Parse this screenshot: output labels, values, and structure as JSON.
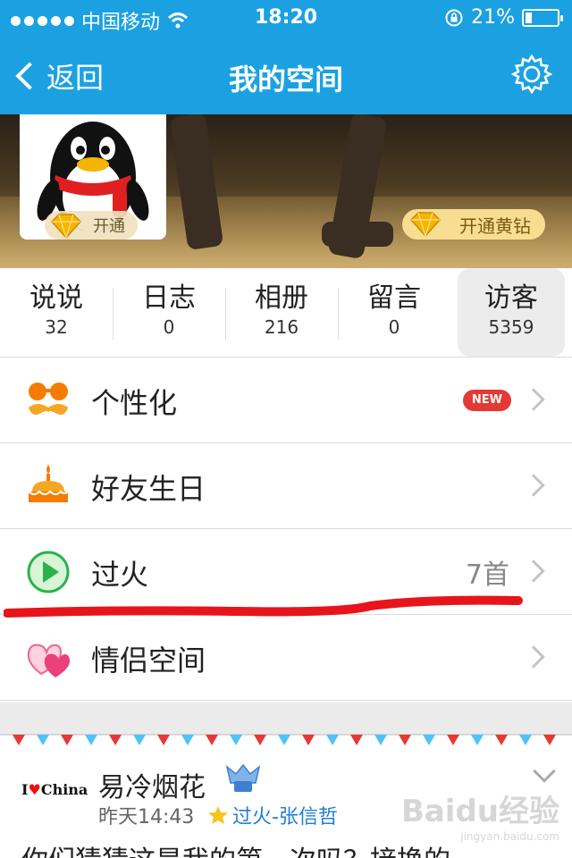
{
  "status": {
    "carrier": "中国移动",
    "time": "18:20",
    "battery": "21%",
    "battery_level": 0.21
  },
  "nav": {
    "back_label": "返回",
    "title": "我的空间"
  },
  "banner": {
    "open_label": "开通",
    "yellow_diamond_label": "开通黄钻"
  },
  "stats": [
    {
      "label": "说说",
      "value": "32"
    },
    {
      "label": "日志",
      "value": "0"
    },
    {
      "label": "相册",
      "value": "216"
    },
    {
      "label": "留言",
      "value": "0"
    },
    {
      "label": "访客",
      "value": "5359"
    }
  ],
  "menu": {
    "items": [
      {
        "label": "个性化",
        "badge": "NEW"
      },
      {
        "label": "好友生日"
      },
      {
        "label": "过火",
        "count": "7首"
      },
      {
        "label": "情侣空间"
      }
    ]
  },
  "feed": {
    "logo_prefix": "I",
    "logo_suffix": "China",
    "name": "易冷烟花",
    "time": "昨天14:43",
    "song": "过火-张信哲",
    "content": "你们猜猜这是我的第一次吗？接换的"
  },
  "watermark": {
    "main": "Baidu经验",
    "sub": "jingyan.baidu.com"
  },
  "colors": {
    "primary": "#1ba1e2",
    "badge_red": "#e53935",
    "link_blue": "#1f7fd6",
    "underline_red": "#e8141c"
  }
}
